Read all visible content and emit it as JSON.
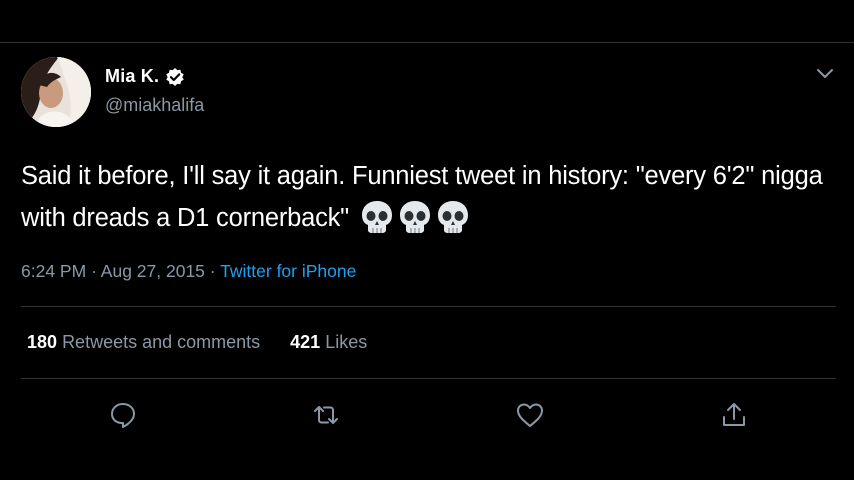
{
  "user": {
    "name": "Mia K.",
    "handle": "@miakhalifa",
    "verified_icon": "verified-badge-icon"
  },
  "tweet": {
    "text": "Said it before, I'll say it again. Funniest tweet in history: \"every 6'2\" nigga with dreads a D1 cornerback\"",
    "emoji": [
      "skull",
      "skull",
      "skull"
    ],
    "time": "6:24 PM",
    "separator": "·",
    "date": "Aug 27, 2015",
    "source": "Twitter for iPhone"
  },
  "stats": {
    "retweets_count": "180",
    "retweets_label": "Retweets and comments",
    "likes_count": "421",
    "likes_label": "Likes"
  },
  "actions": [
    "reply-icon",
    "retweet-icon",
    "like-icon",
    "share-icon"
  ],
  "colors": {
    "background": "#000000",
    "link": "#1da1f2",
    "secondary_text": "#8b98a5",
    "divider": "#2f3336"
  }
}
